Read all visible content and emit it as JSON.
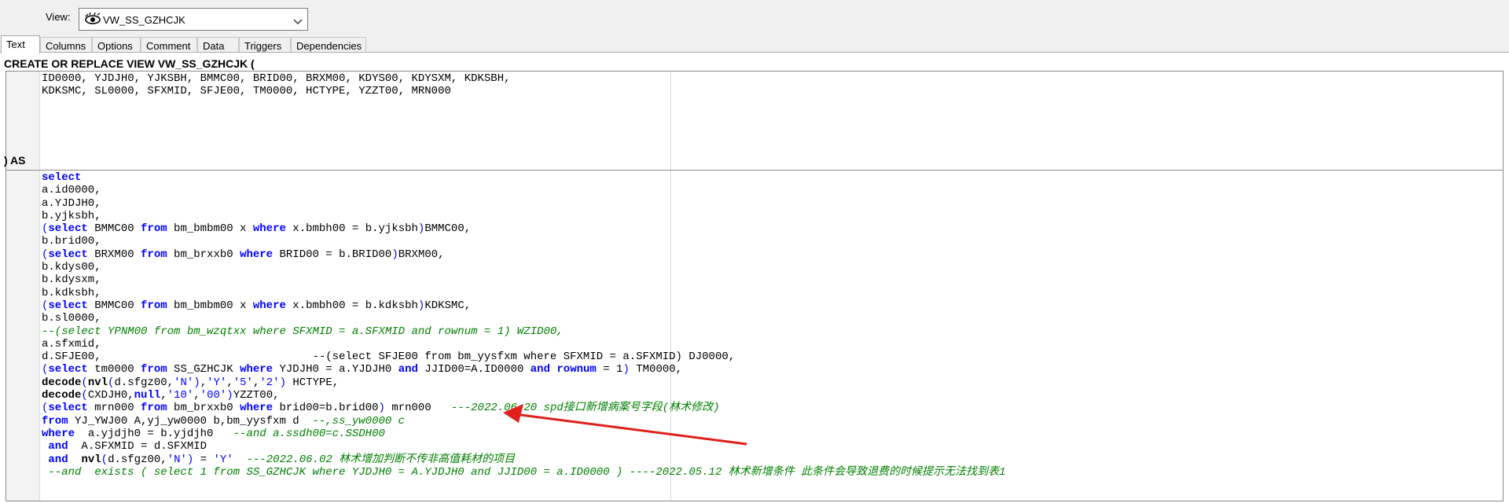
{
  "header": {
    "view_label": "View:",
    "view_name": "VW_SS_GZHCJK"
  },
  "tabs": [
    {
      "label": "Text",
      "active": true
    },
    {
      "label": "Columns"
    },
    {
      "label": "Options"
    },
    {
      "label": "Comment"
    },
    {
      "label": "Data"
    },
    {
      "label": "Triggers"
    },
    {
      "label": "Dependencies"
    }
  ],
  "section_create": "CREATE OR REPLACE VIEW VW_SS_GZHCJK (",
  "section_as": ") AS",
  "columns_lines": [
    "ID0000, YJDJH0, YJKSBH, BMMC00, BRID00, BRXM00, KDYS00, KDYSXM, KDKSBH,",
    "KDKSMC, SL0000, SFXMID, SFJE00, TM0000, HCTYPE, YZZT00, MRN000"
  ],
  "sql_lines": [
    [
      {
        "t": "select",
        "c": "kw"
      }
    ],
    [
      {
        "t": "a.id0000,"
      }
    ],
    [
      {
        "t": "a.YJDJH0,"
      }
    ],
    [
      {
        "t": "b.yjksbh,"
      }
    ],
    [
      {
        "t": "(",
        "c": "p"
      },
      {
        "t": "select",
        "c": "kw"
      },
      {
        "t": " BMMC00 "
      },
      {
        "t": "from",
        "c": "kw"
      },
      {
        "t": " bm_bmbm00 x "
      },
      {
        "t": "where",
        "c": "kw"
      },
      {
        "t": " x.bmbh00 = b.yjksbh"
      },
      {
        "t": ")",
        "c": "p"
      },
      {
        "t": "BMMC00,"
      }
    ],
    [
      {
        "t": "b.brid00,"
      }
    ],
    [
      {
        "t": "(",
        "c": "p"
      },
      {
        "t": "select",
        "c": "kw"
      },
      {
        "t": " BRXM00 "
      },
      {
        "t": "from",
        "c": "kw"
      },
      {
        "t": " bm_brxxb0 "
      },
      {
        "t": "where",
        "c": "kw"
      },
      {
        "t": " BRID00 = b.BRID00"
      },
      {
        "t": ")",
        "c": "p"
      },
      {
        "t": "BRXM00,"
      }
    ],
    [
      {
        "t": "b.kdys00,"
      }
    ],
    [
      {
        "t": "b.kdysxm,"
      }
    ],
    [
      {
        "t": "b.kdksbh,"
      }
    ],
    [
      {
        "t": "(",
        "c": "p"
      },
      {
        "t": "select",
        "c": "kw"
      },
      {
        "t": " BMMC00 "
      },
      {
        "t": "from",
        "c": "kw"
      },
      {
        "t": " bm_bmbm00 x "
      },
      {
        "t": "where",
        "c": "kw"
      },
      {
        "t": " x.bmbh00 = b.kdksbh"
      },
      {
        "t": ")",
        "c": "p"
      },
      {
        "t": "KDKSMC,"
      }
    ],
    [
      {
        "t": "b.sl0000,"
      }
    ],
    [
      {
        "t": "--(select YPNM00 from bm_wzqtxx where SFXMID = a.SFXMID and rownum = 1) WZID00,",
        "c": "cm"
      }
    ],
    [
      {
        "t": "a.sfxmid,"
      }
    ],
    [
      {
        "t": "d.SFJE00,                                --(select SFJE00 from bm_yysfxm where SFXMID = a.SFXMID) DJ0000,"
      }
    ],
    [
      {
        "t": "(",
        "c": "p"
      },
      {
        "t": "select",
        "c": "kw"
      },
      {
        "t": " tm0000 "
      },
      {
        "t": "from",
        "c": "kw"
      },
      {
        "t": " SS_GZHCJK "
      },
      {
        "t": "where",
        "c": "kw"
      },
      {
        "t": " YJDJH0 = a.YJDJH0 "
      },
      {
        "t": "and",
        "c": "kw"
      },
      {
        "t": " JJID00=A.ID0000 "
      },
      {
        "t": "and",
        "c": "kw"
      },
      {
        "t": " "
      },
      {
        "t": "rownum",
        "c": "kw"
      },
      {
        "t": " = 1"
      },
      {
        "t": ")",
        "c": "p"
      },
      {
        "t": " TM0000,"
      }
    ],
    [
      {
        "t": "decode",
        "c": "kwb"
      },
      {
        "t": "(",
        "c": "p"
      },
      {
        "t": "nvl",
        "c": "kwb"
      },
      {
        "t": "(",
        "c": "p"
      },
      {
        "t": "d.sfgz00,"
      },
      {
        "t": "'N'",
        "c": "s"
      },
      {
        "t": ")",
        "c": "p"
      },
      {
        "t": ","
      },
      {
        "t": "'Y'",
        "c": "s"
      },
      {
        "t": ","
      },
      {
        "t": "'5'",
        "c": "s"
      },
      {
        "t": ","
      },
      {
        "t": "'2'",
        "c": "s"
      },
      {
        "t": ")",
        "c": "p"
      },
      {
        "t": " HCTYPE,"
      }
    ],
    [
      {
        "t": "decode",
        "c": "kwb"
      },
      {
        "t": "(",
        "c": "p"
      },
      {
        "t": "CXDJH0,"
      },
      {
        "t": "null",
        "c": "kw"
      },
      {
        "t": ","
      },
      {
        "t": "'10'",
        "c": "s"
      },
      {
        "t": ","
      },
      {
        "t": "'00'",
        "c": "s"
      },
      {
        "t": ")",
        "c": "p"
      },
      {
        "t": "YZZT00,"
      }
    ],
    [
      {
        "t": "(",
        "c": "p"
      },
      {
        "t": "select",
        "c": "kw"
      },
      {
        "t": " mrn000 "
      },
      {
        "t": "from",
        "c": "kw"
      },
      {
        "t": " bm_brxxb0 "
      },
      {
        "t": "where",
        "c": "kw"
      },
      {
        "t": " brid00=b.brid00"
      },
      {
        "t": ")",
        "c": "p"
      },
      {
        "t": " mrn000   "
      },
      {
        "t": "---2022.06.20 spd接口新增病案号字段(林术修改)",
        "c": "cm"
      }
    ],
    [
      {
        "t": "from",
        "c": "kw"
      },
      {
        "t": " YJ_YWJ00 A,yj_yw0000 b,bm_yysfxm d  "
      },
      {
        "t": "--,ss_yw0000 c",
        "c": "cm"
      }
    ],
    [
      {
        "t": "where",
        "c": "kw"
      },
      {
        "t": "  a.yjdjh0 = b.yjdjh0   "
      },
      {
        "t": "--and a.ssdh00=c.SSDH00",
        "c": "cm"
      }
    ],
    [
      {
        "t": " "
      },
      {
        "t": "and",
        "c": "kw"
      },
      {
        "t": "  A.SFXMID = d.SFXMID"
      }
    ],
    [
      {
        "t": " "
      },
      {
        "t": "and",
        "c": "kw"
      },
      {
        "t": "  "
      },
      {
        "t": "nvl",
        "c": "kwb"
      },
      {
        "t": "(",
        "c": "p"
      },
      {
        "t": "d.sfgz00,"
      },
      {
        "t": "'N'",
        "c": "s"
      },
      {
        "t": ")",
        "c": "p"
      },
      {
        "t": " = "
      },
      {
        "t": "'Y'",
        "c": "s"
      },
      {
        "t": "  "
      },
      {
        "t": "---2022.06.02 林术增加判断不传非高值耗材的项目",
        "c": "cm"
      }
    ],
    [
      {
        "t": " --and  exists ( select 1 from SS_GZHCJK where YJDJH0 = A.YJDJH0 and JJID00 = a.ID0000 ) ----2022.05.12 林术新增条件 此条件会导致退费的时候提示无法找到表1",
        "c": "cm"
      }
    ]
  ],
  "colors": {
    "keyword": "#0000ff",
    "comment": "#008000",
    "arrow": "#e0201a"
  },
  "icons": {
    "view_icon": "eye-icon",
    "dropdown": "chevron-down-icon"
  }
}
